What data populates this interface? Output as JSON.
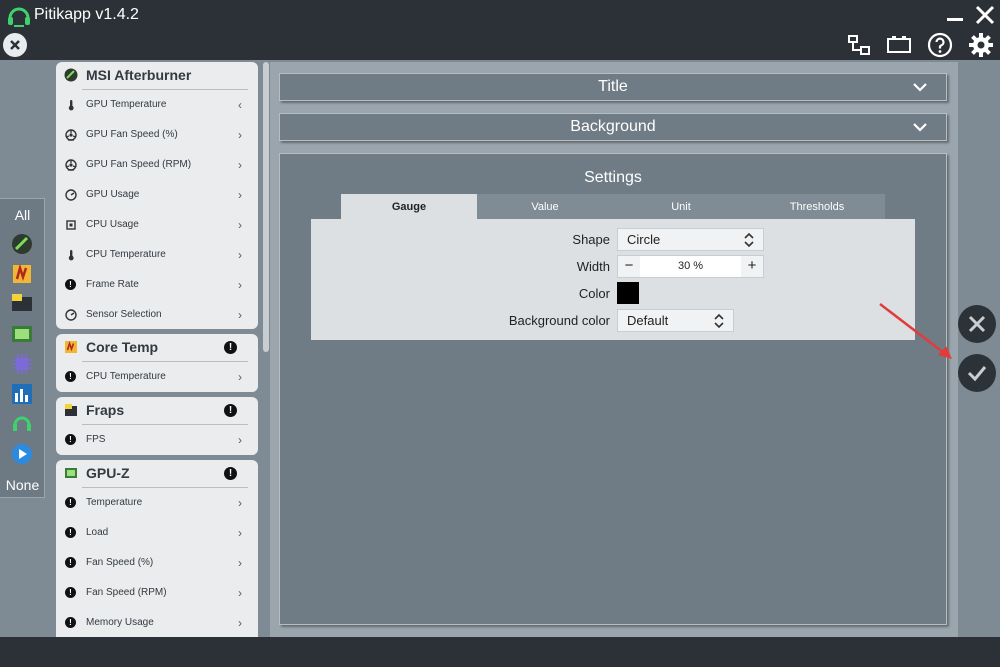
{
  "app": {
    "title": "Pitikapp v1.4.2",
    "logo_icon": "headset-logo-icon"
  },
  "window": {
    "minimize_icon": "minimize-icon",
    "close_icon": "close-icon"
  },
  "toolbar": {
    "icons": [
      "network-icon",
      "battery-icon",
      "help-icon",
      "gear-icon"
    ]
  },
  "filter": {
    "all_label": "All",
    "none_label": "None"
  },
  "groups": [
    {
      "title": "MSI Afterburner",
      "warning": false,
      "items": [
        {
          "label": "GPU Temperature",
          "icon": "thermometer-icon",
          "chevron": "‹"
        },
        {
          "label": "GPU Fan Speed (%)",
          "icon": "fan-icon",
          "chevron": "›"
        },
        {
          "label": "GPU Fan Speed (RPM)",
          "icon": "fan-icon",
          "chevron": "›"
        },
        {
          "label": "GPU Usage",
          "icon": "gauge-icon",
          "chevron": "›"
        },
        {
          "label": "CPU Usage",
          "icon": "chip-icon",
          "chevron": "›"
        },
        {
          "label": "CPU Temperature",
          "icon": "thermometer-icon",
          "chevron": "›"
        },
        {
          "label": "Frame Rate",
          "icon": "warning-icon",
          "chevron": "›"
        },
        {
          "label": "Sensor Selection",
          "icon": "gauge-icon",
          "chevron": "›"
        }
      ]
    },
    {
      "title": "Core Temp",
      "warning": true,
      "items": [
        {
          "label": "CPU Temperature",
          "icon": "warning-icon",
          "chevron": "›"
        }
      ]
    },
    {
      "title": "Fraps",
      "warning": true,
      "items": [
        {
          "label": "FPS",
          "icon": "warning-icon",
          "chevron": "›"
        }
      ]
    },
    {
      "title": "GPU-Z",
      "warning": true,
      "items": [
        {
          "label": "Temperature",
          "icon": "warning-icon",
          "chevron": "›"
        },
        {
          "label": "Load",
          "icon": "warning-icon",
          "chevron": "›"
        },
        {
          "label": "Fan Speed (%)",
          "icon": "warning-icon",
          "chevron": "›"
        },
        {
          "label": "Fan Speed (RPM)",
          "icon": "warning-icon",
          "chevron": "›"
        },
        {
          "label": "Memory Usage",
          "icon": "warning-icon",
          "chevron": "›"
        }
      ]
    }
  ],
  "panels": {
    "title_label": "Title",
    "background_label": "Background",
    "settings_label": "Settings"
  },
  "tabs": [
    {
      "label": "Gauge",
      "active": true
    },
    {
      "label": "Value",
      "active": false
    },
    {
      "label": "Unit",
      "active": false
    },
    {
      "label": "Thresholds",
      "active": false
    }
  ],
  "gauge": {
    "shape_label": "Shape",
    "shape_value": "Circle",
    "width_label": "Width",
    "width_value": "30 %",
    "minus_label": "−",
    "plus_label": "+",
    "color_label": "Color",
    "color_value": "#000000",
    "bg_color_label": "Background color",
    "bg_color_value": "Default"
  },
  "actions": {
    "cancel_icon": "cancel-icon",
    "confirm_icon": "checkmark-icon"
  },
  "colors": {
    "titlebar": "#2b3137",
    "main_bg": "#7e8b94",
    "panel": "#6f7c85",
    "tab_active": "#dde0e2",
    "annotation_arrow": "#e03c3c"
  }
}
